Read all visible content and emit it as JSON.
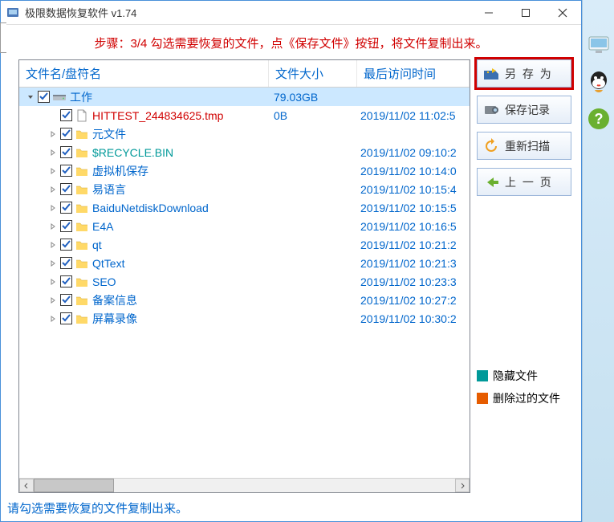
{
  "titlebar": {
    "title": "极限数据恢复软件 v1.74"
  },
  "instruction": "步骤：3/4 勾选需要恢复的文件，点《保存文件》按钮，将文件复制出来。",
  "columns": {
    "name": "文件名/盘符名",
    "size": "文件大小",
    "date": "最后访问时间"
  },
  "files": [
    {
      "depth": 0,
      "expander": "down",
      "checked": true,
      "icon": "drive",
      "name": "工作",
      "color": "blue",
      "size": "79.03GB",
      "date": "",
      "selected": true
    },
    {
      "depth": 1,
      "expander": "none",
      "checked": true,
      "icon": "file",
      "name": "HITTEST_244834625.tmp",
      "color": "red",
      "size": "0B",
      "date": "2019/11/02 11:02:5"
    },
    {
      "depth": 1,
      "expander": "right",
      "checked": true,
      "icon": "folder",
      "name": "元文件",
      "color": "blue",
      "size": "",
      "date": ""
    },
    {
      "depth": 1,
      "expander": "right",
      "checked": true,
      "icon": "folder",
      "name": "$RECYCLE.BIN",
      "color": "teal",
      "size": "",
      "date": "2019/11/02 09:10:2"
    },
    {
      "depth": 1,
      "expander": "right",
      "checked": true,
      "icon": "folder",
      "name": "虚拟机保存",
      "color": "blue",
      "size": "",
      "date": "2019/11/02 10:14:0"
    },
    {
      "depth": 1,
      "expander": "right",
      "checked": true,
      "icon": "folder",
      "name": "易语言",
      "color": "blue",
      "size": "",
      "date": "2019/11/02 10:15:4"
    },
    {
      "depth": 1,
      "expander": "right",
      "checked": true,
      "icon": "folder",
      "name": "BaiduNetdiskDownload",
      "color": "blue",
      "size": "",
      "date": "2019/11/02 10:15:5"
    },
    {
      "depth": 1,
      "expander": "right",
      "checked": true,
      "icon": "folder",
      "name": "E4A",
      "color": "blue",
      "size": "",
      "date": "2019/11/02 10:16:5"
    },
    {
      "depth": 1,
      "expander": "right",
      "checked": true,
      "icon": "folder",
      "name": "qt",
      "color": "blue",
      "size": "",
      "date": "2019/11/02 10:21:2"
    },
    {
      "depth": 1,
      "expander": "right",
      "checked": true,
      "icon": "folder",
      "name": "QtText",
      "color": "blue",
      "size": "",
      "date": "2019/11/02 10:21:3"
    },
    {
      "depth": 1,
      "expander": "right",
      "checked": true,
      "icon": "folder",
      "name": "SEO",
      "color": "blue",
      "size": "",
      "date": "2019/11/02 10:23:3"
    },
    {
      "depth": 1,
      "expander": "right",
      "checked": true,
      "icon": "folder",
      "name": "备案信息",
      "color": "blue",
      "size": "",
      "date": "2019/11/02 10:27:2"
    },
    {
      "depth": 1,
      "expander": "right",
      "checked": true,
      "icon": "folder",
      "name": "屏幕录像",
      "color": "blue",
      "size": "",
      "date": "2019/11/02 10:30:2"
    }
  ],
  "buttons": {
    "save_as": "另 存 为",
    "save_record": "保存记录",
    "rescan": "重新扫描",
    "prev": "上 一 页"
  },
  "legend": {
    "hidden": {
      "color": "#009999",
      "label": "隐藏文件"
    },
    "deleted": {
      "color": "#e65c00",
      "label": "删除过的文件"
    }
  },
  "statusbar": "请勾选需要恢复的文件复制出来。"
}
